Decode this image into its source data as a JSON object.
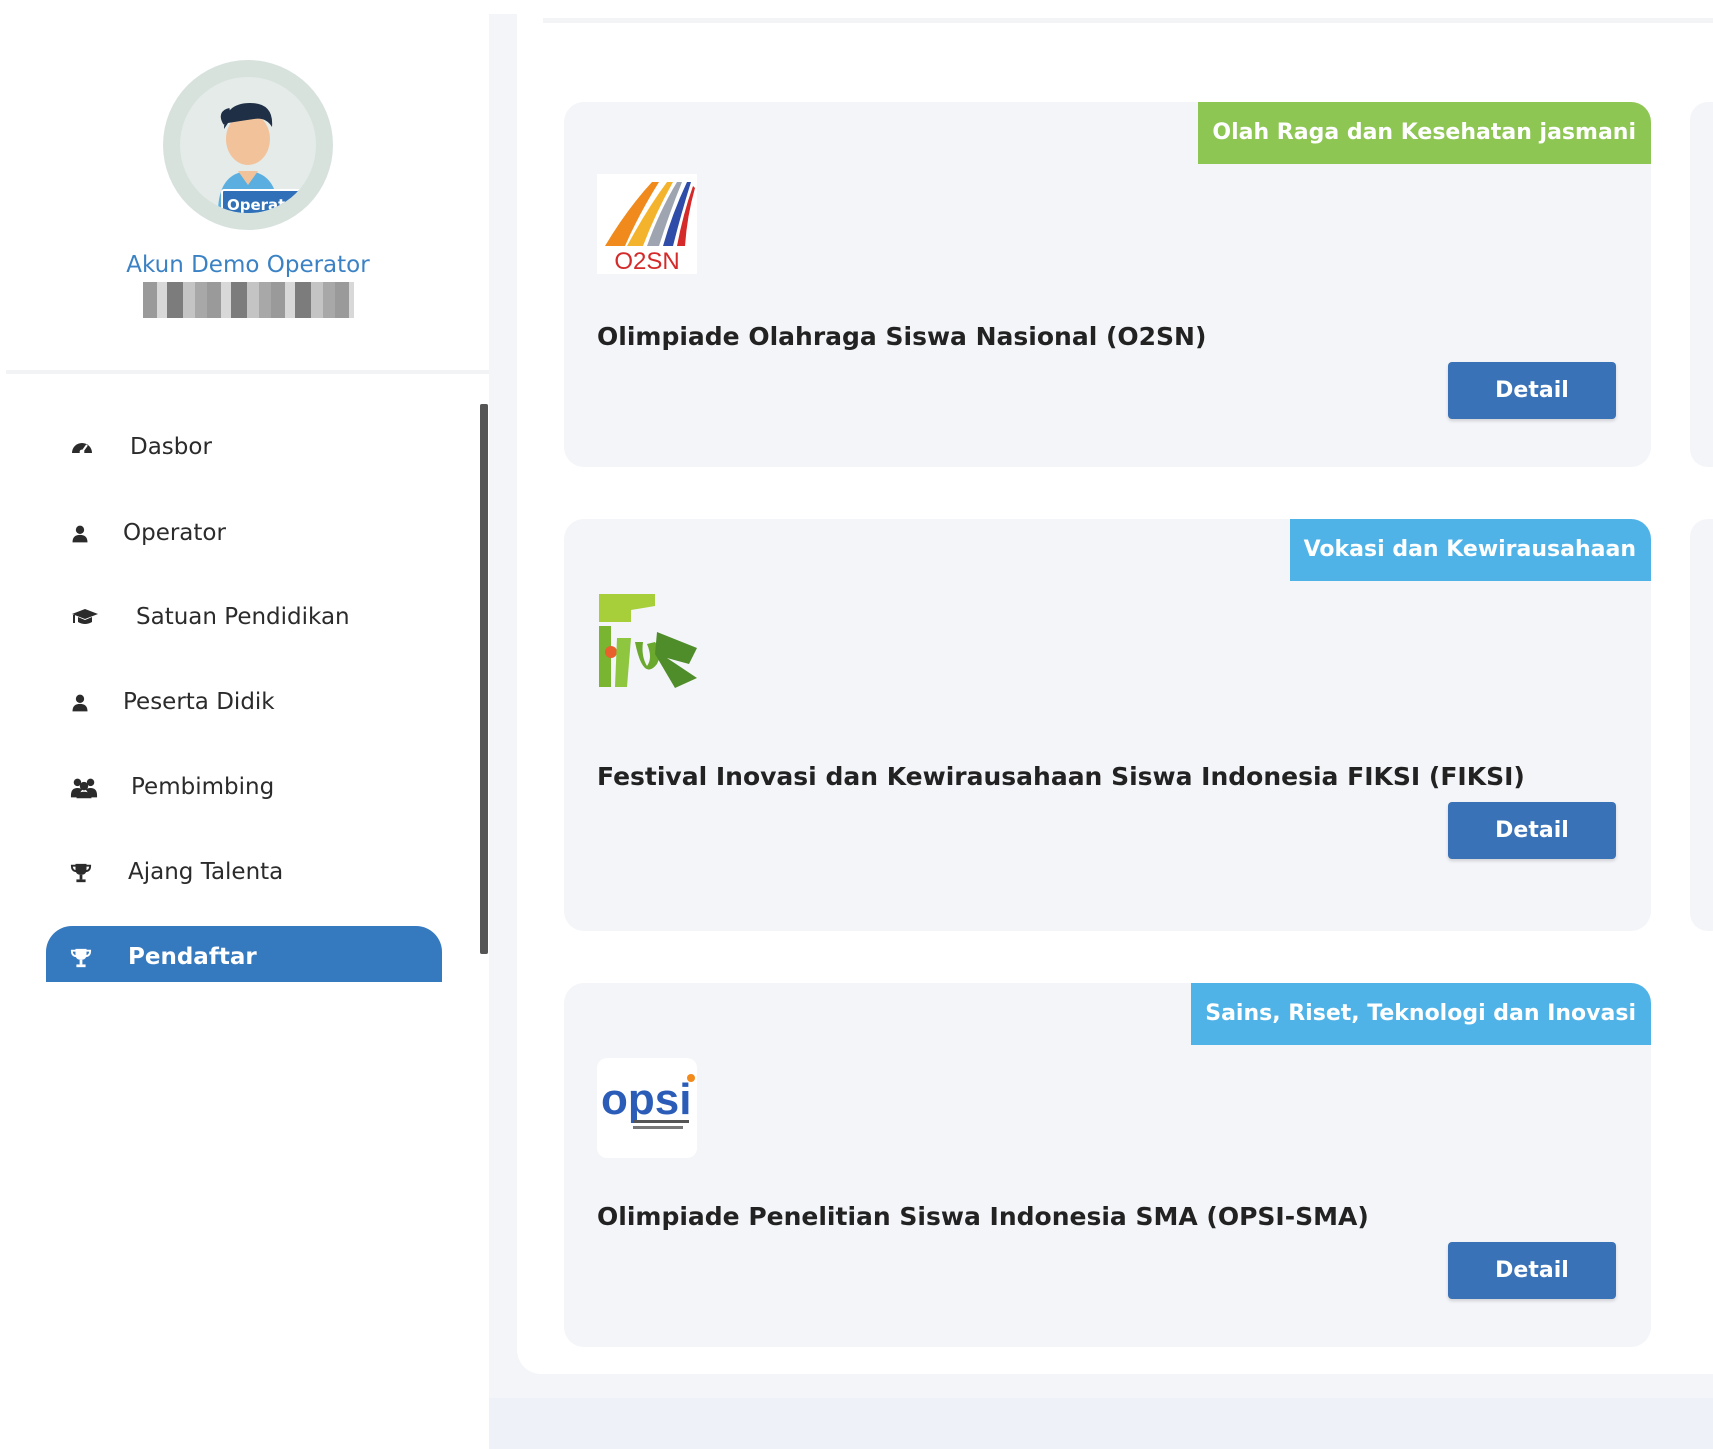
{
  "profile": {
    "badge": "Operator",
    "name": "Akun Demo Operator"
  },
  "nav": {
    "items": [
      {
        "label": "Dasbor",
        "icon": "dashboard-icon"
      },
      {
        "label": "Operator",
        "icon": "user-icon"
      },
      {
        "label": "Satuan Pendidikan",
        "icon": "graduation-cap-icon"
      },
      {
        "label": "Peserta Didik",
        "icon": "user-icon"
      },
      {
        "label": "Pembimbing",
        "icon": "users-icon"
      },
      {
        "label": "Ajang Talenta",
        "icon": "trophy-icon"
      },
      {
        "label": "Pendaftar",
        "icon": "trophy-icon",
        "active": true
      }
    ]
  },
  "cards": [
    {
      "category": "Olah Raga dan Kesehatan jasmani",
      "category_color": "#8ec653",
      "title": "Olimpiade Olahraga Siswa Nasional (O2SN)",
      "button": "Detail",
      "logo_text": "O2SN"
    },
    {
      "category": "Vokasi dan Kewirausahaan",
      "category_color": "#4fb3e8",
      "title": "Festival Inovasi dan Kewirausahaan Siswa Indonesia FIKSI (FIKSI)",
      "button": "Detail"
    },
    {
      "category": "Sains, Riset, Teknologi dan Inovasi",
      "category_color": "#4fb3e8",
      "title": "Olimpiade Penelitian Siswa Indonesia SMA (OPSI-SMA)",
      "button": "Detail",
      "logo_text": "opsi"
    }
  ],
  "colors": {
    "accent": "#3579bf",
    "button": "#3a72b8",
    "link": "#3b82c4"
  }
}
